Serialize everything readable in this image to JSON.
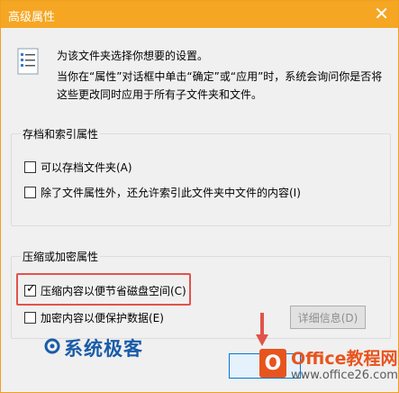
{
  "window": {
    "title": "高级属性",
    "close_label": "✕"
  },
  "description": {
    "line1": "为该文件夹选择你想要的设置。",
    "line2": "当你在“属性”对话框中单击“确定”或“应用”时，系统会询问你是否将这些更改同时应用于所有子文件夹和文件。"
  },
  "archive_group": {
    "title": "存档和索引属性",
    "options": [
      {
        "label": "可以存档文件夹(A)",
        "checked": false
      },
      {
        "label": "除了文件属性外，还允许索引此文件夹中文件的内容(I)",
        "checked": false
      }
    ]
  },
  "compress_group": {
    "title": "压缩或加密属性",
    "options": [
      {
        "label": "压缩内容以便节省磁盘空间(C)",
        "checked": true
      },
      {
        "label": "加密内容以便保护数据(E)",
        "checked": false
      }
    ],
    "details_button": "详细信息(D)"
  },
  "ok_button": "",
  "watermarks": {
    "site1": "系统极客",
    "site2_line1": "Office教程网",
    "site2_line2": "www.office26.com"
  },
  "colors": {
    "titlebar": "#f5a623",
    "highlight": "#e2534a",
    "arrow": "#e2534a"
  }
}
